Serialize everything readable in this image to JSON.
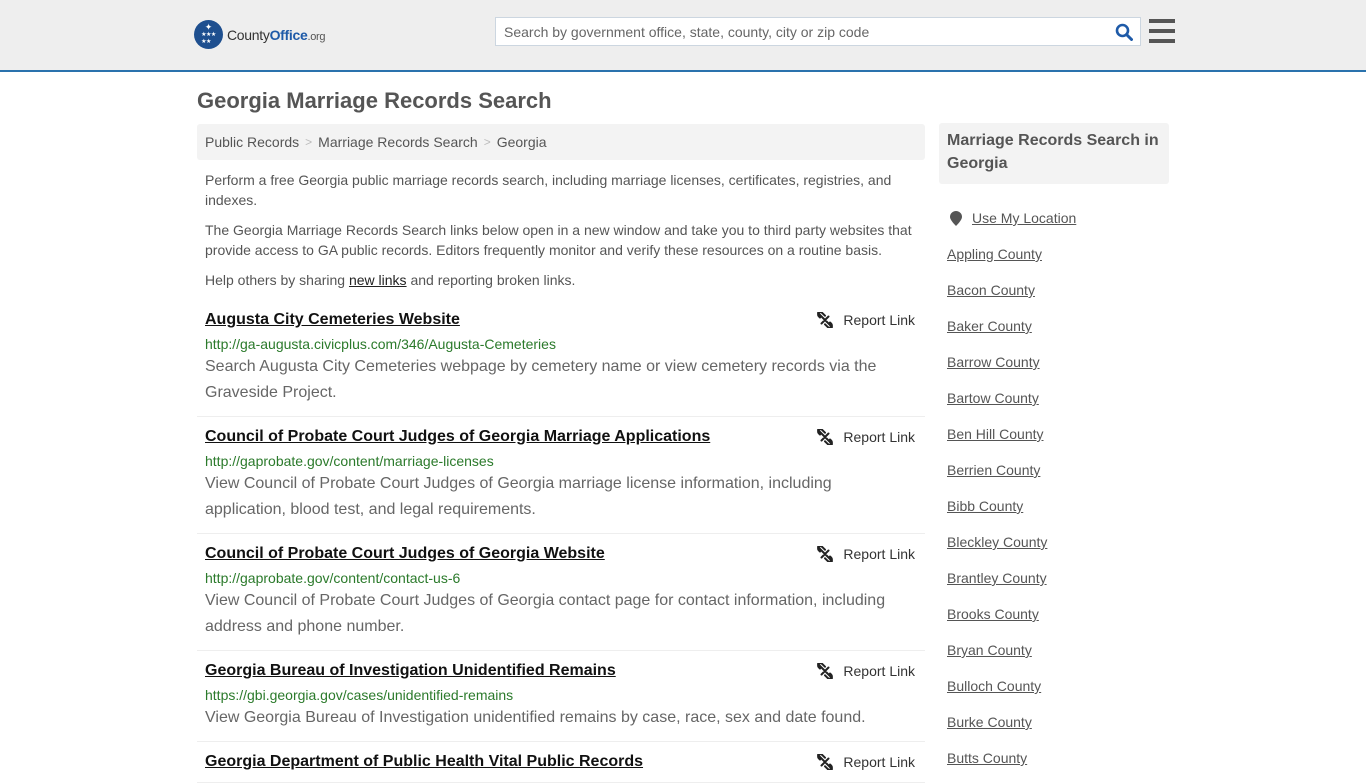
{
  "header": {
    "logo": {
      "name_part1": "County",
      "name_part2": "Office",
      "name_part3": ".org"
    },
    "search": {
      "placeholder": "Search by government office, state, county, city or zip code",
      "value": ""
    },
    "icons": {
      "search": "search-icon",
      "menu": "hamburger-menu-icon"
    },
    "accent_color": "#2a72ad"
  },
  "page_title": "Georgia Marriage Records Search",
  "breadcrumb": [
    {
      "label": "Public Records"
    },
    {
      "label": "Marriage Records Search"
    },
    {
      "label": "Georgia"
    }
  ],
  "intro": {
    "p1": "Perform a free Georgia public marriage records search, including marriage licenses, certificates, registries, and indexes.",
    "p2": "The Georgia Marriage Records Search links below open in a new window and take you to third party websites that provide access to GA public records. Editors frequently monitor and verify these resources on a routine basis.",
    "p3_before": "Help others by sharing ",
    "p3_link": "new links",
    "p3_after": " and reporting broken links."
  },
  "report_label": "Report Link",
  "results": [
    {
      "title": "Augusta City Cemeteries Website",
      "url": "http://ga-augusta.civicplus.com/346/Augusta-Cemeteries",
      "desc": "Search Augusta City Cemeteries webpage by cemetery name or view cemetery records via the Graveside Project."
    },
    {
      "title": "Council of Probate Court Judges of Georgia Marriage Applications",
      "url": "http://gaprobate.gov/content/marriage-licenses",
      "desc": "View Council of Probate Court Judges of Georgia marriage license information, including application, blood test, and legal requirements."
    },
    {
      "title": "Council of Probate Court Judges of Georgia Website",
      "url": "http://gaprobate.gov/content/contact-us-6",
      "desc": "View Council of Probate Court Judges of Georgia contact page for contact information, including address and phone number."
    },
    {
      "title": "Georgia Bureau of Investigation Unidentified Remains",
      "url": "https://gbi.georgia.gov/cases/unidentified-remains",
      "desc": "View Georgia Bureau of Investigation unidentified remains by case, race, sex and date found."
    },
    {
      "title": "Georgia Department of Public Health Vital Public Records",
      "url": "",
      "desc": ""
    }
  ],
  "sidebar": {
    "heading": "Marriage Records Search in Georgia",
    "use_location": "Use My Location",
    "counties": [
      "Appling County",
      "Bacon County",
      "Baker County",
      "Barrow County",
      "Bartow County",
      "Ben Hill County",
      "Berrien County",
      "Bibb County",
      "Bleckley County",
      "Brantley County",
      "Brooks County",
      "Bryan County",
      "Bulloch County",
      "Burke County",
      "Butts County"
    ]
  }
}
